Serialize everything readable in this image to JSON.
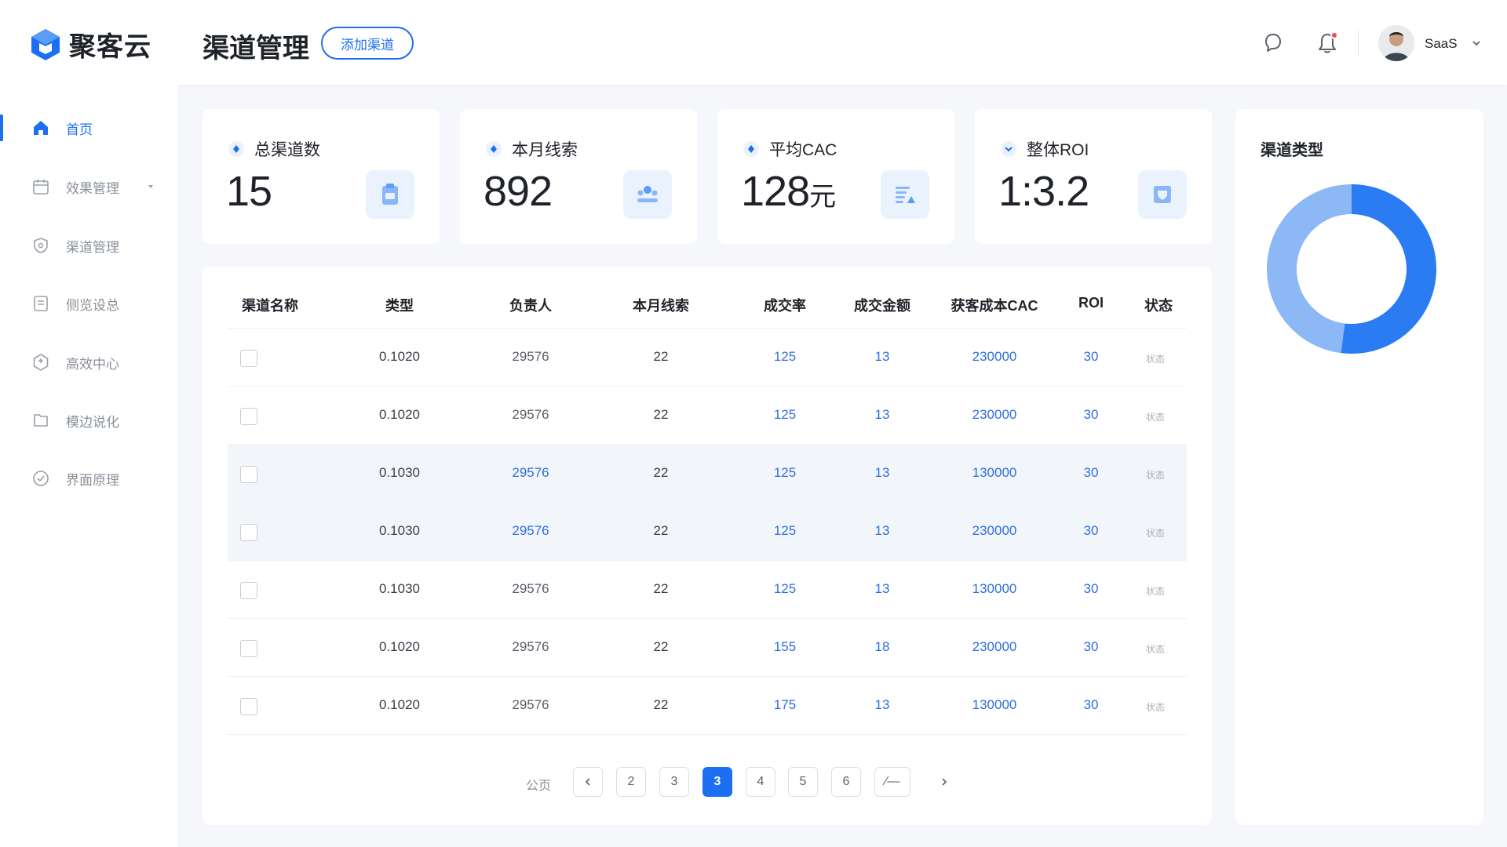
{
  "header": {
    "brand": "聚客云",
    "page_title": "渠道管理",
    "add_button": "添加渠道",
    "user_name": "SaaS",
    "accent": "#1d6ff2"
  },
  "sidebar": {
    "items": [
      {
        "label": "首页",
        "icon": "home-icon",
        "active": true
      },
      {
        "label": "效果管理",
        "icon": "calendar-icon",
        "expandable": true
      },
      {
        "label": "渠道管理",
        "icon": "shield-icon"
      },
      {
        "label": "侧览设总",
        "icon": "document-icon"
      },
      {
        "label": "高效中心",
        "icon": "hexagon-icon"
      },
      {
        "label": "模边说化",
        "icon": "folder-icon"
      },
      {
        "label": "界面原理",
        "icon": "check-circle-icon"
      }
    ]
  },
  "stats": [
    {
      "label": "总渠道数",
      "value": "15",
      "unit": "",
      "icon": "clipboard-icon"
    },
    {
      "label": "本月线索",
      "value": "892",
      "unit": "",
      "icon": "people-icon"
    },
    {
      "label": "平均CAC",
      "value": "128",
      "unit": "元",
      "icon": "chart-list-icon"
    },
    {
      "label": "整体ROI",
      "value": "1:3.2",
      "unit": "",
      "icon": "shield-check-icon"
    }
  ],
  "table": {
    "columns": [
      "渠道名称",
      "类型",
      "负责人",
      "本月线索",
      "成交率",
      "成交金额",
      "获客成本CAC",
      "ROI",
      "状态"
    ],
    "rows": [
      {
        "type": "0.1020",
        "owner": "29576",
        "leads": "22",
        "rate": "125",
        "amount": "13",
        "cac": "230000",
        "roi": "30",
        "status": "状态"
      },
      {
        "type": "0.1020",
        "owner": "29576",
        "leads": "22",
        "rate": "125",
        "amount": "13",
        "cac": "230000",
        "roi": "30",
        "status": "状态"
      },
      {
        "type": "0.1030",
        "owner": "29576",
        "leads": "22",
        "rate": "125",
        "amount": "13",
        "cac": "130000",
        "roi": "30",
        "status": "状态"
      },
      {
        "type": "0.1030",
        "owner": "29576",
        "leads": "22",
        "rate": "125",
        "amount": "13",
        "cac": "230000",
        "roi": "30",
        "status": "状态"
      },
      {
        "type": "0.1030",
        "owner": "29576",
        "leads": "22",
        "rate": "125",
        "amount": "13",
        "cac": "130000",
        "roi": "30",
        "status": "状态"
      },
      {
        "type": "0.1020",
        "owner": "29576",
        "leads": "22",
        "rate": "155",
        "amount": "18",
        "cac": "230000",
        "roi": "30",
        "status": "状态"
      },
      {
        "type": "0.1020",
        "owner": "29576",
        "leads": "22",
        "rate": "175",
        "amount": "13",
        "cac": "130000",
        "roi": "30",
        "status": "状态"
      }
    ]
  },
  "pagination": {
    "label": "公页",
    "pages": [
      "2",
      "3",
      "3",
      "4",
      "5",
      "6",
      "⁄—"
    ],
    "active_index": 2
  },
  "donut": {
    "title": "渠道类型",
    "segments": [
      {
        "value": 52,
        "color": "#2b7bf3"
      },
      {
        "value": 48,
        "color": "#8db8f6"
      }
    ]
  }
}
